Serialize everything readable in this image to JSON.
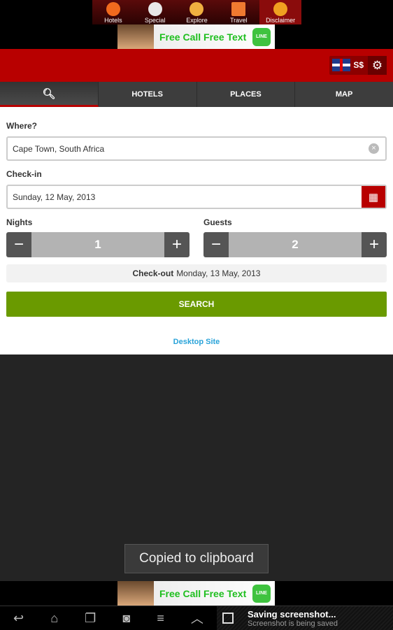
{
  "top_nav": {
    "items": [
      {
        "label": "Hotels",
        "icon": "globe-icon",
        "color": "#f06a1e"
      },
      {
        "label": "Special",
        "icon": "info-icon",
        "color": "#e8e8e8"
      },
      {
        "label": "Explore",
        "icon": "lightbulb-icon",
        "color": "#f0b040"
      },
      {
        "label": "Travel",
        "icon": "travel-icon",
        "color": "#f07a30"
      },
      {
        "label": "Disclaimer",
        "icon": "hand-icon",
        "color": "#f0a020"
      }
    ]
  },
  "ad": {
    "text": "Free Call Free Text",
    "brand": "LINE"
  },
  "header": {
    "currency": "S$",
    "language_flag": "uk-flag"
  },
  "tabs": [
    {
      "label": "",
      "icon": "search-icon"
    },
    {
      "label": "HOTELS"
    },
    {
      "label": "PLACES"
    },
    {
      "label": "MAP"
    }
  ],
  "form": {
    "where_label": "Where?",
    "where_value": "Cape Town, South Africa",
    "checkin_label": "Check-in",
    "checkin_value": "Sunday, 12 May, 2013",
    "nights_label": "Nights",
    "nights_value": "1",
    "guests_label": "Guests",
    "guests_value": "2",
    "checkout_label": "Check-out",
    "checkout_value": "Monday, 13 May, 2013",
    "search_label": "SEARCH",
    "desktop_link": "Desktop Site"
  },
  "toast": "Copied to clipboard",
  "notification": {
    "title": "Saving screenshot...",
    "subtitle": "Screenshot is being saved"
  },
  "colors": {
    "brand_red": "#b80000",
    "search_green": "#6a9a00",
    "link_blue": "#29a3d9"
  }
}
